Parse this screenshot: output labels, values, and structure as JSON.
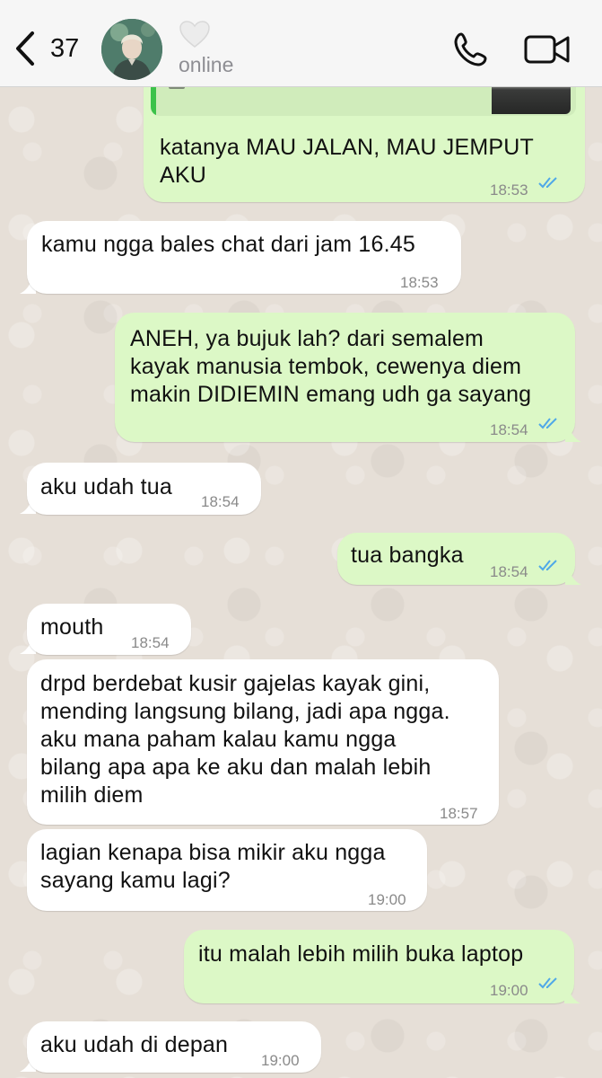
{
  "header": {
    "back_count": "37",
    "status": "online"
  },
  "messages": [
    {
      "dir": "out",
      "text": "katanya MAU JALAN, MAU JEMPUT\nAKU",
      "time": "18:53",
      "read": true
    },
    {
      "dir": "in",
      "text": "kamu ngga bales chat dari jam 16.45",
      "time": "18:53"
    },
    {
      "dir": "out",
      "text": "ANEH, ya bujuk lah? dari semalem\nkayak manusia tembok, cewenya diem\nmakin DIDIEMIN emang udh ga sayang",
      "time": "18:54",
      "read": true
    },
    {
      "dir": "in",
      "text": "aku udah tua",
      "time": "18:54"
    },
    {
      "dir": "out",
      "text": "tua bangka",
      "time": "18:54",
      "read": true
    },
    {
      "dir": "in",
      "text": "mouth",
      "time": "18:54"
    },
    {
      "dir": "in",
      "text": "drpd berdebat kusir gajelas kayak gini,\nmending langsung bilang, jadi apa ngga.\naku mana paham kalau kamu ngga\nbilang apa apa ke aku dan malah lebih\nmilih diem",
      "time": "18:57"
    },
    {
      "dir": "in",
      "text": "lagian kenapa bisa mikir aku ngga\nsayang kamu lagi?",
      "time": "19:00"
    },
    {
      "dir": "out",
      "text": "itu malah lebih milih buka laptop",
      "time": "19:00",
      "read": true
    },
    {
      "dir": "in",
      "text": "aku udah di depan",
      "time": "19:00"
    }
  ],
  "colors": {
    "outgoing_bubble": "#dcf8c6",
    "incoming_bubble": "#ffffff",
    "read_ticks": "#4fa8e8",
    "wallpaper": "#e6dfd7",
    "quote_bar": "#3cc24a"
  }
}
